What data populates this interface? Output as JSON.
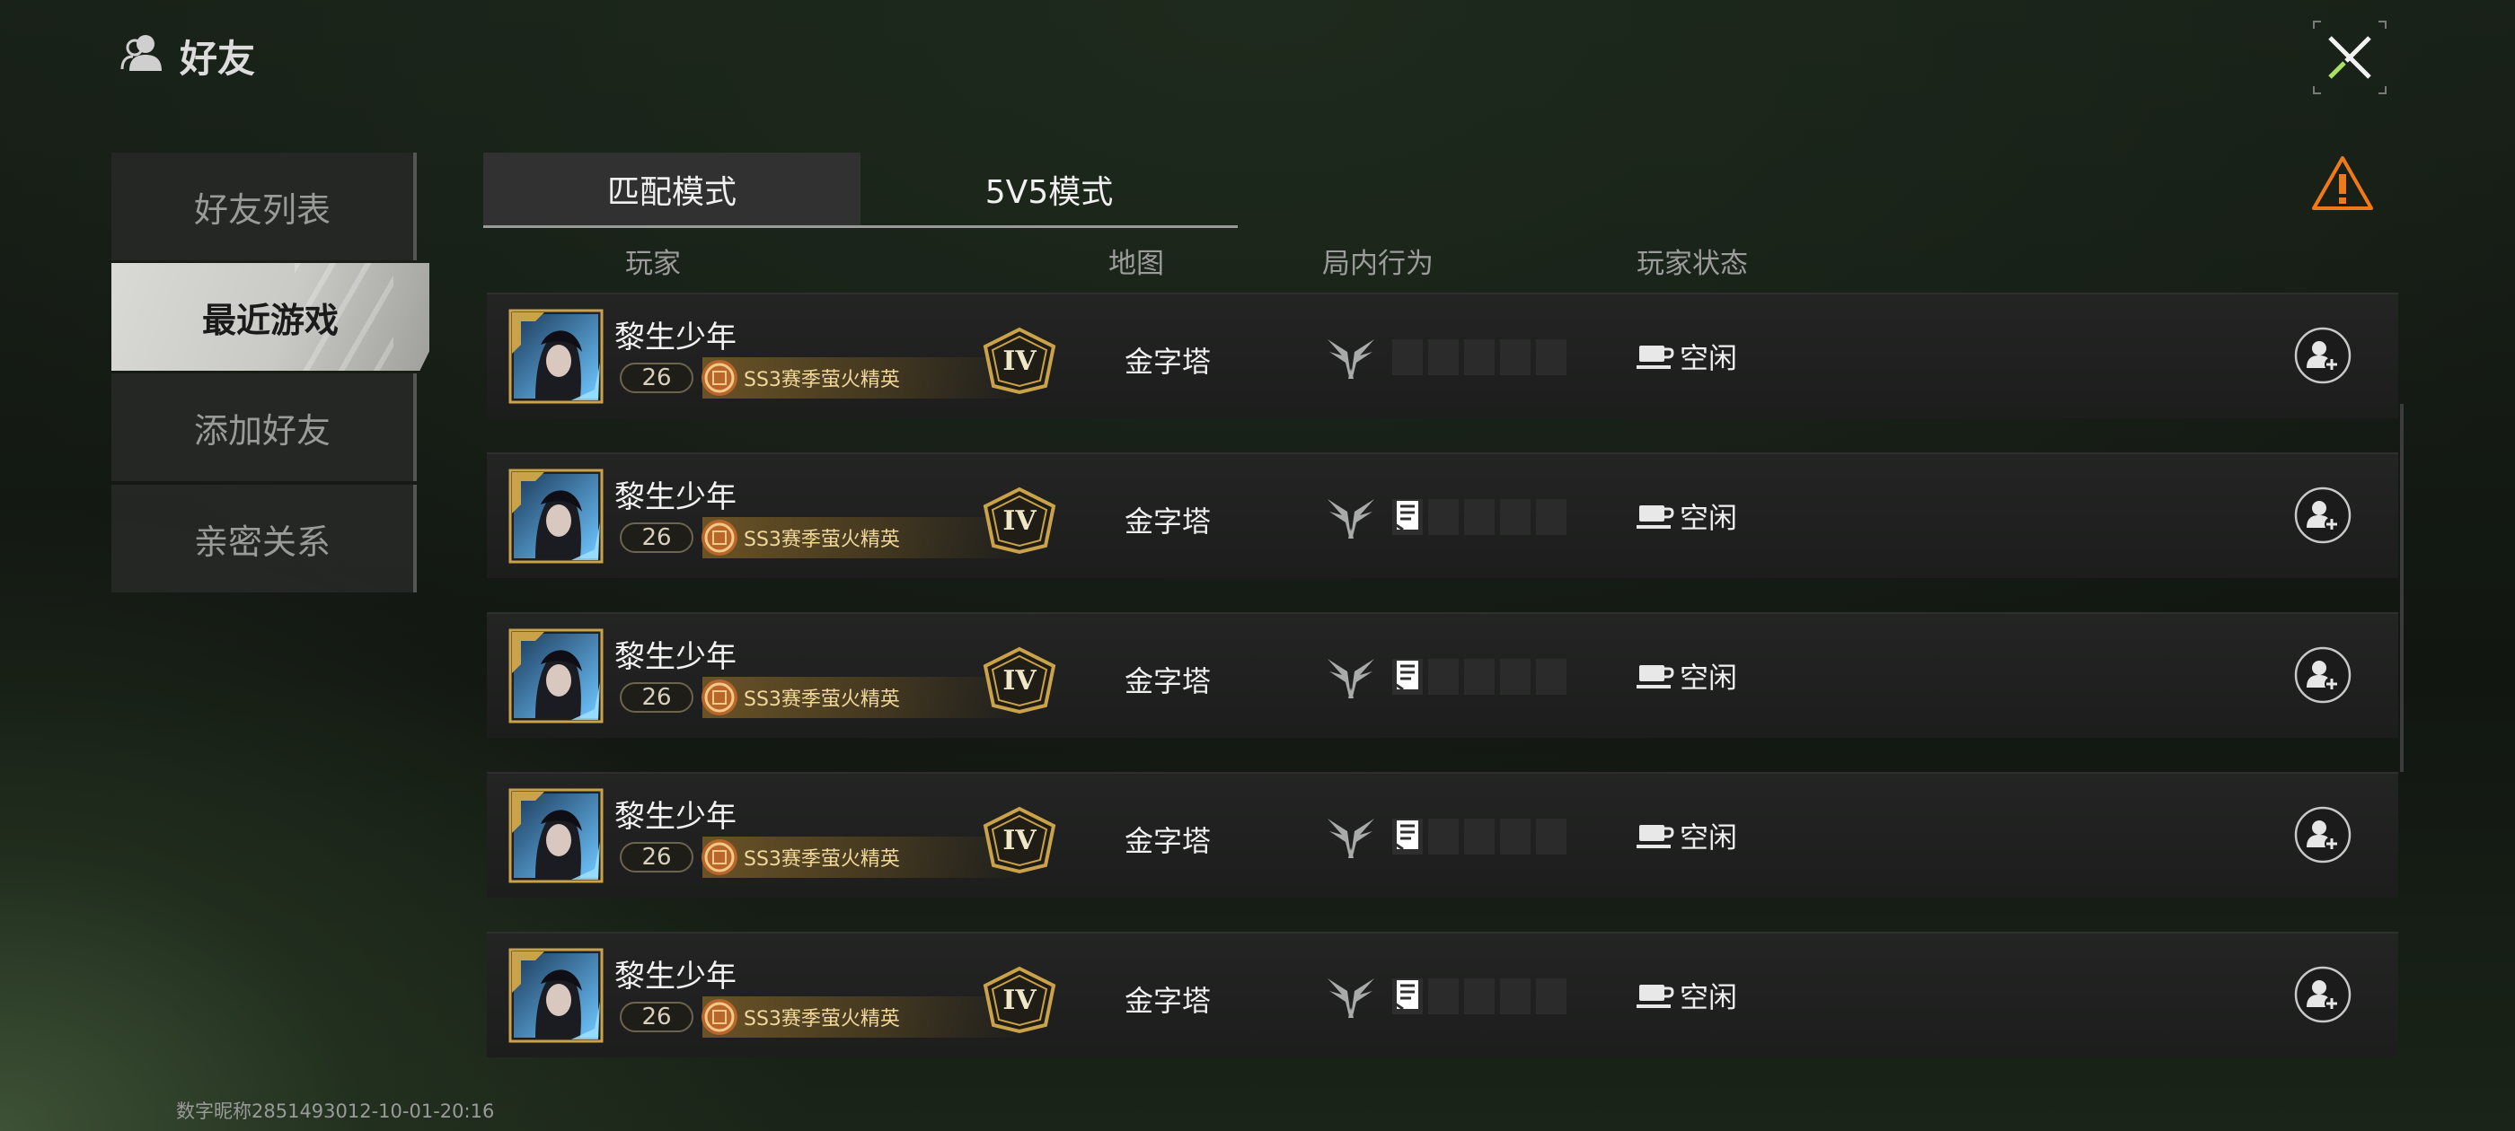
{
  "header": {
    "title": "好友",
    "icon": "friends-icon"
  },
  "sidebar": {
    "items": [
      {
        "label": "好友列表",
        "active": false
      },
      {
        "label": "最近游戏",
        "active": true
      },
      {
        "label": "添加好友",
        "active": false
      },
      {
        "label": "亲密关系",
        "active": false
      }
    ]
  },
  "tabs": [
    {
      "label": "匹配模式",
      "active": true
    },
    {
      "label": "5V5模式",
      "active": false
    }
  ],
  "columns": {
    "player": "玩家",
    "map": "地图",
    "behavior": "局内行为",
    "status": "玩家状态"
  },
  "rows": [
    {
      "name": "黎生少年",
      "level": "26",
      "title": "SS3赛季萤火精英",
      "rank": "IV",
      "map": "金字塔",
      "status": "空闲",
      "item_slots_filled": 0
    },
    {
      "name": "黎生少年",
      "level": "26",
      "title": "SS3赛季萤火精英",
      "rank": "IV",
      "map": "金字塔",
      "status": "空闲",
      "item_slots_filled": 1
    },
    {
      "name": "黎生少年",
      "level": "26",
      "title": "SS3赛季萤火精英",
      "rank": "IV",
      "map": "金字塔",
      "status": "空闲",
      "item_slots_filled": 1
    },
    {
      "name": "黎生少年",
      "level": "26",
      "title": "SS3赛季萤火精英",
      "rank": "IV",
      "map": "金字塔",
      "status": "空闲",
      "item_slots_filled": 1
    },
    {
      "name": "黎生少年",
      "level": "26",
      "title": "SS3赛季萤火精英",
      "rank": "IV",
      "map": "金字塔",
      "status": "空闲",
      "item_slots_filled": 1
    }
  ],
  "footer": {
    "id_text": "数字昵称2851493012-10-01-20:16"
  },
  "colors": {
    "accent_orange": "#f07a1a",
    "gold": "#c9a24a",
    "active_tab_bg": "#d3d4d0"
  }
}
